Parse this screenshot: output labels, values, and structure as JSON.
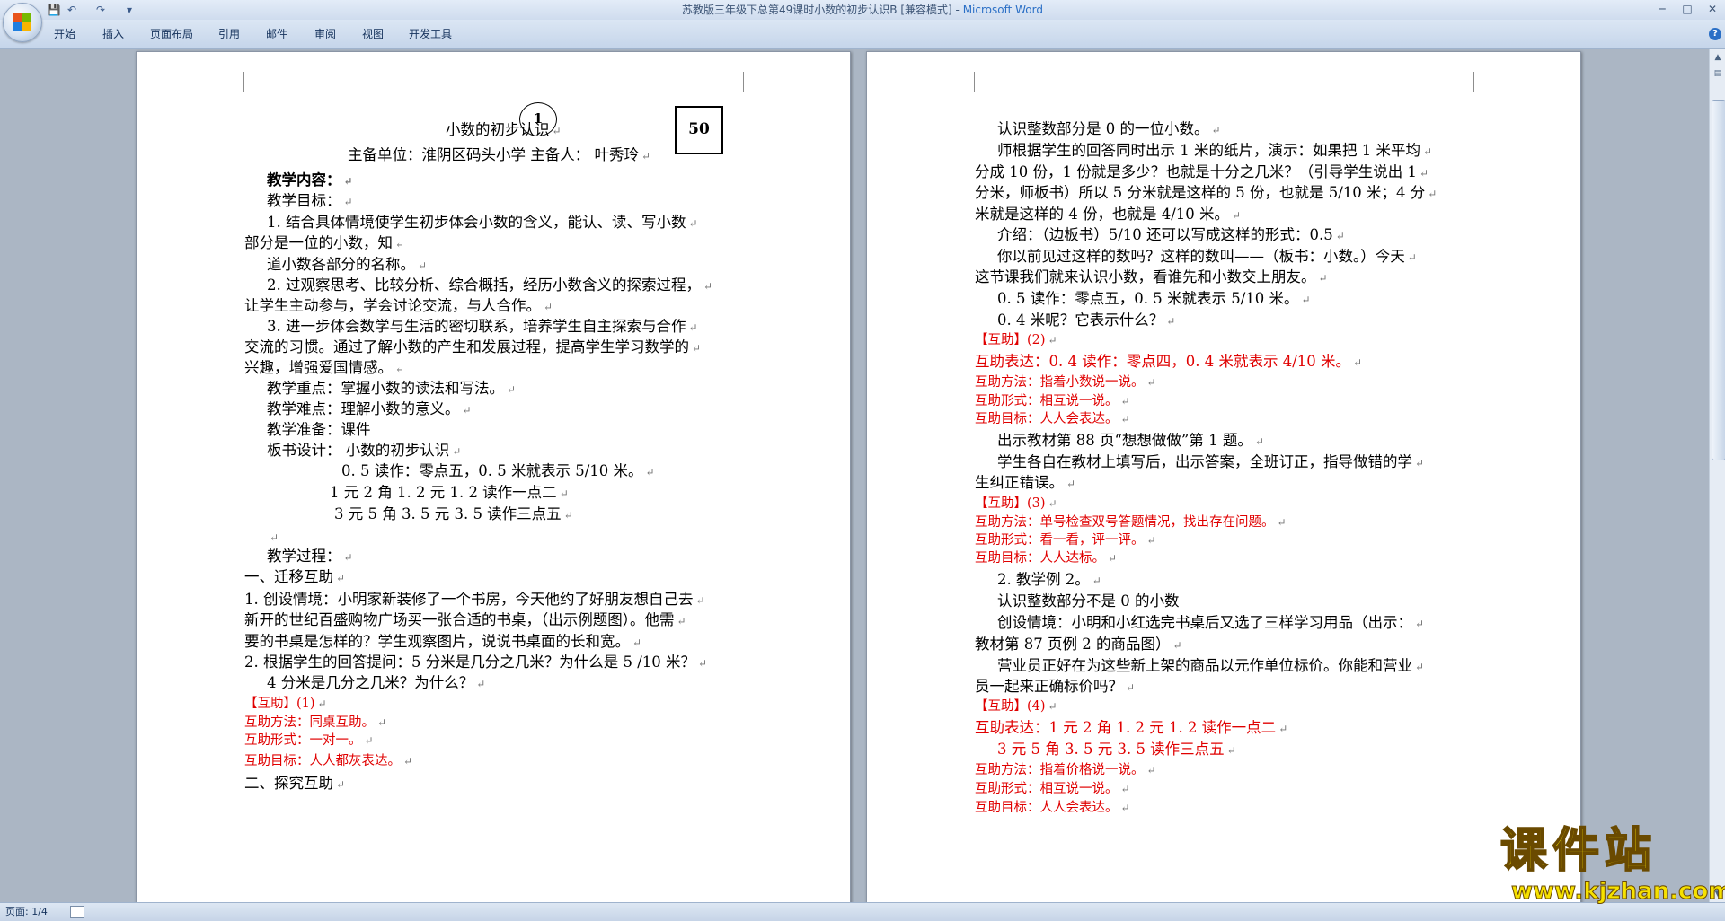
{
  "window": {
    "doc_name": "苏教版三年级下总第49课时小数的初步认识B [兼容模式]",
    "separator": " - ",
    "app_name": "Microsoft Word"
  },
  "qat": {
    "save": "💾",
    "undo": "↶",
    "redo": "↷",
    "customize": "▾"
  },
  "window_controls": {
    "minimize": "─",
    "maximize": "□",
    "close": "✕"
  },
  "ribbon_tabs": [
    "开始",
    "插入",
    "页面布局",
    "引用",
    "邮件",
    "审阅",
    "视图",
    "开发工具"
  ],
  "help": "?",
  "page1": {
    "number_circle": "1",
    "number_box": "50",
    "title": "小数的初步认识",
    "host_line": "主备单位：淮阴区码头小学     主备人：  叶秀玲",
    "lines": [
      "教学内容：",
      "教学目标：",
      "1. 结合具体情境使学生初步体会小数的含义，能认、读、写小数",
      "部分是一位的小数，知",
      "道小数各部分的名称。",
      "2. 过观察思考、比较分析、综合概括，经历小数含义的探索过程，",
      "让学生主动参与，学会讨论交流，与人合作。",
      "3. 进一步体会数学与生活的密切联系，培养学生自主探索与合作",
      "交流的习惯。通过了解小数的产生和发展过程，提高学生学习数学的",
      "兴趣，增强爱国情感。",
      "教学重点：掌握小数的读法和写法。",
      "教学难点：理解小数的意义。",
      "教学准备：课件",
      "板书设计：         小数的初步认识",
      "0. 5 读作：零点五，0. 5 米就表示 5/10 米。",
      "1 元 2 角 1. 2 元 1. 2 读作一点二",
      "3 元 5 角 3. 5 元 3. 5 读作三点五",
      "",
      "教学过程：",
      "一、迁移互助",
      "1. 创设情境：小明家新装修了一个书房，今天他约了好朋友想自己去",
      "新开的世纪百盛购物广场买一张合适的书桌，（出示例题图）。他需",
      "要的书桌是怎样的？学生观察图片，说说书桌面的长和宽。",
      "2. 根据学生的回答提问：5 分米是几分之几米？为什么是 5 /10 米？",
      "4 分米是几分之几米？为什么？",
      "【互助】(1)",
      "互助方法：同桌互助。",
      "互助形式：一对一。",
      "互助目标：人人都灰表达。",
      "二、探究互助"
    ]
  },
  "page2": {
    "lines": [
      "认识整数部分是 0 的一位小数。",
      "师根据学生的回答同时出示 1 米的纸片，演示：如果把 1 米平均",
      "分成 10 份，1 份就是多少？也就是十分之几米？（引导学生说出 1",
      "分米，师板书）所以 5 分米就是这样的 5 份，也就是 5/10 米；4 分",
      "米就是这样的 4 份，也就是 4/10 米。",
      "介绍：（边板书）5/10 还可以写成这样的形式：0.5",
      "你以前见过这样的数吗？这样的数叫——（板书：小数。）今天",
      "这节课我们就来认识小数，看谁先和小数交上朋友。",
      "0. 5 读作：零点五，0. 5 米就表示 5/10 米。",
      "0. 4 米呢？它表示什么？",
      "【互助】(2)",
      "互助表达：0. 4 读作：零点四，0. 4 米就表示 4/10 米。",
      "互助方法：指着小数说一说。",
      "互助形式：相互说一说。",
      "互助目标：人人会表达。",
      "出示教材第 88 页“想想做做”第 1 题。",
      "学生各自在教材上填写后，出示答案，全班订正，指导做错的学",
      "生纠正错误。",
      "【互助】(3)",
      "互助方法：单号检查双号答题情况，找出存在问题。",
      "互助形式：看一看，评一评。",
      "互助目标：人人达标。",
      "2. 教学例 2。",
      "认识整数部分不是 0 的小数",
      "创设情境：小明和小红选完书桌后又选了三样学习用品（出示：",
      "教材第 87 页例 2 的商品图）",
      "营业员正好在为这些新上架的商品以元作单位标价。你能和营业",
      "员一起来正确标价吗？",
      "【互助】(4)",
      "互助表达：1 元 2 角 1. 2 元 1. 2 读作一点二",
      "3 元 5 角 3. 5 元 3. 5 读作三点五",
      "互助方法：指着价格说一说。",
      "互助形式：相互说一说。",
      "互助目标：人人会表达。"
    ]
  },
  "paragraph_mark": "↵",
  "status": {
    "page_indicator": "页面: 1/4"
  },
  "watermark": {
    "title": "课件站",
    "url": "www.kjzhan.com"
  },
  "colors": {
    "accent": "#2a6fc6",
    "red_text": "#e00000",
    "watermark": "#f6e100"
  }
}
